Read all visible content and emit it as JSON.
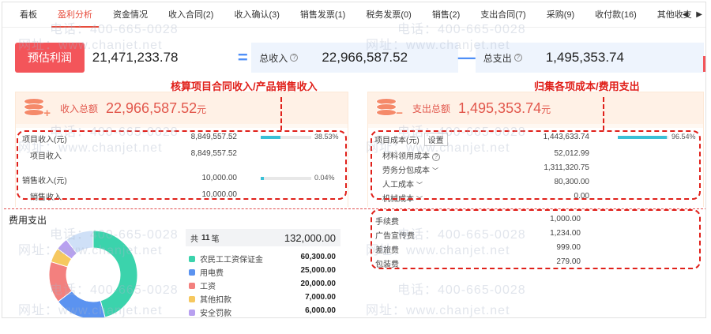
{
  "tabs": [
    {
      "label": "看板",
      "active": false
    },
    {
      "label": "盈利分析",
      "active": true
    },
    {
      "label": "资金情况",
      "active": false
    },
    {
      "label": "收入合同(2)",
      "active": false
    },
    {
      "label": "收入确认(3)",
      "active": false
    },
    {
      "label": "销售发票(1)",
      "active": false
    },
    {
      "label": "税务发票(0)",
      "active": false
    },
    {
      "label": "销售(2)",
      "active": false
    },
    {
      "label": "支出合同(7)",
      "active": false
    },
    {
      "label": "采购(9)",
      "active": false
    },
    {
      "label": "收付款(16)",
      "active": false
    },
    {
      "label": "其他收支",
      "active": false
    }
  ],
  "formula": {
    "profit_label": "预估利润",
    "profit_value": "21,471,233.78",
    "equals": "=",
    "income_label": "总收入",
    "income_value": "22,966,587.52",
    "minus": "—",
    "expense_label": "总支出",
    "expense_value": "1,495,353.74"
  },
  "annotations": {
    "income_note": "核算项目合同收入/产品销售收入",
    "expense_note": "归集各项成本/费用支出"
  },
  "income_card": {
    "title": "收入总额",
    "amount": "22,966,587.52",
    "unit": "元",
    "rows": [
      {
        "label": "项目收入(元)",
        "value": "8,849,557.52",
        "pct": "38.53%",
        "fill": 0.3853
      },
      {
        "label": "项目收入",
        "value": "8,849,557.52",
        "sub": true
      },
      {
        "label": "销售收入(元)",
        "value": "10,000.00",
        "pct": "0.04%",
        "fill": 0.04
      },
      {
        "label": "销售收入",
        "value": "10,000.00",
        "sub": true
      }
    ]
  },
  "expense_card": {
    "title": "支出总额",
    "amount": "1,495,353.74",
    "unit": "元",
    "header_label": "项目成本(元)",
    "settings_label": "设置",
    "header_value": "1,443,633.74",
    "header_pct": "96.54%",
    "header_fill": 0.9654,
    "rows": [
      {
        "label": "材料领用成本",
        "value": "52,012.99",
        "suffix": "help"
      },
      {
        "label": "劳务分包成本",
        "value": "1,311,320.75",
        "suffix": "chevron"
      },
      {
        "label": "人工成本",
        "value": "80,300.00",
        "suffix": "chevron"
      },
      {
        "label": "机械成本",
        "value": "0.00",
        "suffix": "chevron"
      }
    ]
  },
  "fees": [
    {
      "label": "手续费",
      "value": "1,000.00"
    },
    {
      "label": "广告宣传费",
      "value": "1,234.00"
    },
    {
      "label": "差旅费",
      "value": "999.00"
    },
    {
      "label": "包装费",
      "value": "279.00"
    }
  ],
  "expense_panel": {
    "title": "费用支出",
    "count_prefix": "共",
    "count": "11",
    "count_suffix": "笔",
    "total": "132,000.00",
    "items": [
      {
        "name": "农民工工资保证金",
        "value": "60,300.00",
        "amount": 60300,
        "color": "#3bd3ac"
      },
      {
        "name": "用电费",
        "value": "25,000.00",
        "amount": 25000,
        "color": "#5b93f0"
      },
      {
        "name": "工资",
        "value": "20,000.00",
        "amount": 20000,
        "color": "#f3807e"
      },
      {
        "name": "其他扣款",
        "value": "7,000.00",
        "amount": 7000,
        "color": "#f6c85f"
      },
      {
        "name": "安全罚款",
        "value": "6,000.00",
        "amount": 6000,
        "color": "#b8a0f0"
      }
    ],
    "other_color": "#cfe0f7",
    "other_amount": 13700
  },
  "watermarks": [
    "电话：400-665-0028",
    "网址：www.chanjet.net"
  ]
}
